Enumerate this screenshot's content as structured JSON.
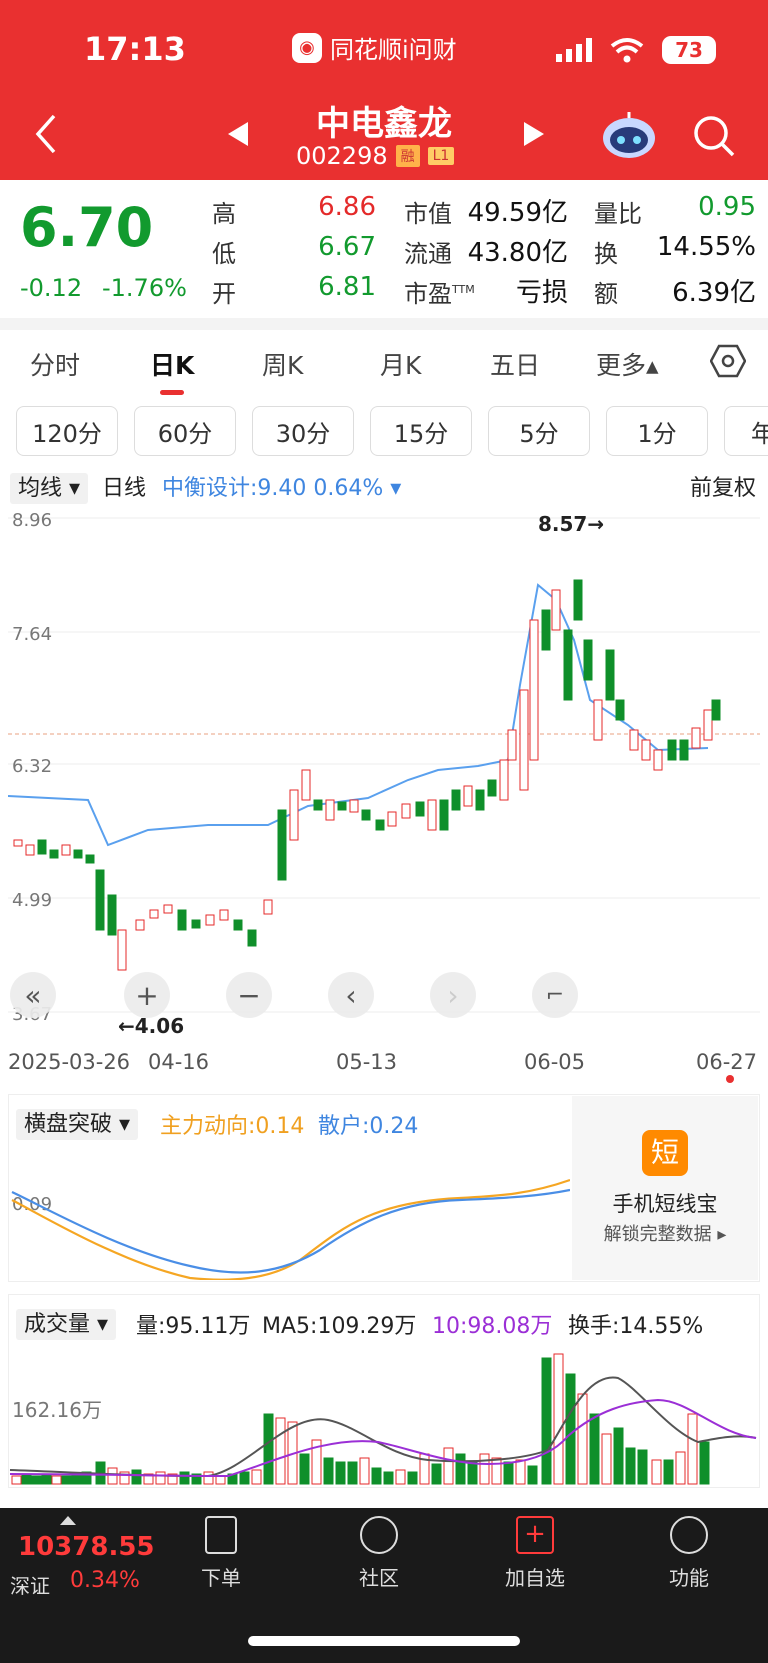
{
  "status": {
    "time": "17:13",
    "app": "同花顺i问财",
    "battery": "73"
  },
  "stock": {
    "name": "中电鑫龙",
    "code": "002298",
    "tags": [
      "融",
      "L1"
    ]
  },
  "quote": {
    "price": "6.70",
    "change": "-0.12",
    "change_pct": "-1.76%",
    "high_label": "高",
    "high": "6.86",
    "low_label": "低",
    "low": "6.67",
    "open_label": "开",
    "open": "6.81",
    "mktcap_label": "市值",
    "mktcap": "49.59亿",
    "float_label": "流通",
    "float": "43.80亿",
    "pe_label": "市盈",
    "pe_sup": "TTM",
    "pe": "亏损",
    "vr_label": "量比",
    "vr": "0.95",
    "turnover_label": "换",
    "turnover": "14.55%",
    "amount_label": "额",
    "amount": "6.39亿"
  },
  "tabs": [
    "分时",
    "日K",
    "周K",
    "月K",
    "五日",
    "更多▴"
  ],
  "periods": [
    "120分",
    "60分",
    "30分",
    "15分",
    "5分",
    "1分",
    "年"
  ],
  "chart": {
    "ma_dropdown": "均线",
    "line_type": "日线",
    "design": "中衡设计:9.40",
    "design_pct": "0.64%",
    "adjust": "前复权",
    "ylabels": [
      "8.96",
      "7.64",
      "6.32",
      "4.99",
      "3.67"
    ],
    "high_marker": "8.57→",
    "low_marker": "←4.06",
    "dates": [
      "2025-03-26",
      "04-16",
      "05-13",
      "06-05",
      "06-27"
    ]
  },
  "indicator": {
    "name": "横盘突破",
    "main_label": "主力动向:0.14",
    "retail_label": "散户:0.24",
    "ylabel": "0.09",
    "promo_icon": "短",
    "promo_title": "手机短线宝",
    "promo_sub": "解锁完整数据 ▸"
  },
  "volume": {
    "name": "成交量",
    "vol": "量:95.11万",
    "ma5": "MA5:109.29万",
    "ma10": "10:98.08万",
    "turnover": "换手:14.55%",
    "ylabel": "162.16万"
  },
  "nav": {
    "index_value": "10378.55",
    "index_name": "深证",
    "index_pct": "0.34%",
    "items": [
      "下单",
      "社区",
      "加自选",
      "功能"
    ]
  },
  "chart_data": {
    "type": "candlestick",
    "title": "中电鑫龙 日K",
    "xlabel": "",
    "ylabel": "",
    "ylim": [
      3.67,
      8.96
    ],
    "x_ticks": [
      "2025-03-26",
      "04-16",
      "05-13",
      "06-05",
      "06-27"
    ],
    "annotations": [
      {
        "text": "8.57→",
        "value": 8.57
      },
      {
        "text": "←4.06",
        "value": 4.06
      }
    ],
    "last_close": 6.7
  }
}
